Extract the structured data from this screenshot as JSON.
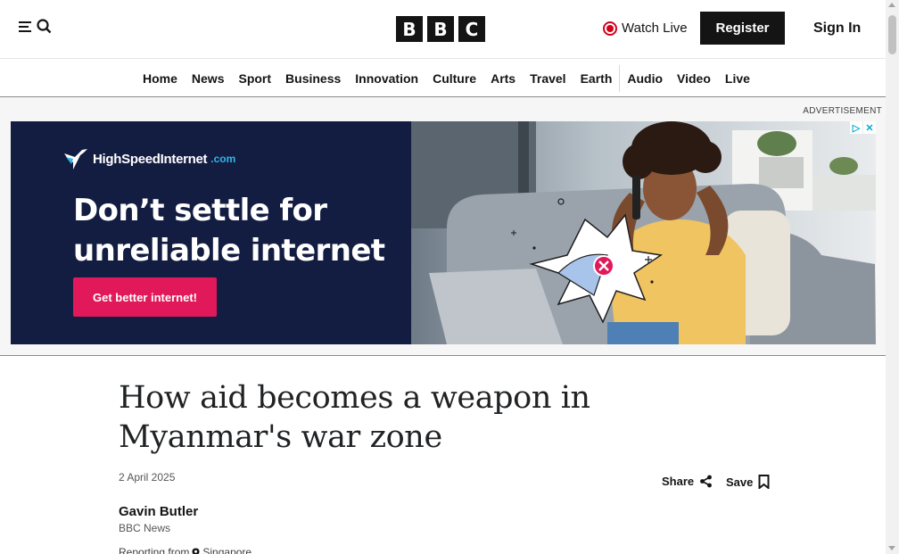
{
  "header": {
    "logo_letters": [
      "B",
      "B",
      "C"
    ],
    "watch_live_label": "Watch Live",
    "register_label": "Register",
    "signin_label": "Sign In"
  },
  "nav": {
    "items": [
      "Home",
      "News",
      "Sport",
      "Business",
      "Innovation",
      "Culture",
      "Arts",
      "Travel",
      "Earth",
      "Audio",
      "Video",
      "Live"
    ]
  },
  "advert": {
    "label": "ADVERTISEMENT",
    "brand_name": "HighSpeedInternet",
    "brand_domain": ".com",
    "headline_line1": "Don’t settle for",
    "headline_line2": "unreliable internet",
    "cta_label": "Get better internet!",
    "colors": {
      "panel": "#131d42",
      "cta": "#e1185a",
      "brand_accent": "#33b5e5"
    }
  },
  "article": {
    "headline": "How aid becomes a weapon in Myanmar's war zone",
    "date": "2 April 2025",
    "share_label": "Share",
    "save_label": "Save",
    "author": "Gavin Butler",
    "author_org": "BBC News",
    "reporting_prefix": "Reporting from",
    "reporting_location": "Singapore"
  },
  "icons": {
    "menu": "menu-icon",
    "search": "search-icon",
    "live": "live-dot-icon",
    "share": "share-icon",
    "save": "bookmark-icon",
    "location": "location-pin-icon"
  }
}
